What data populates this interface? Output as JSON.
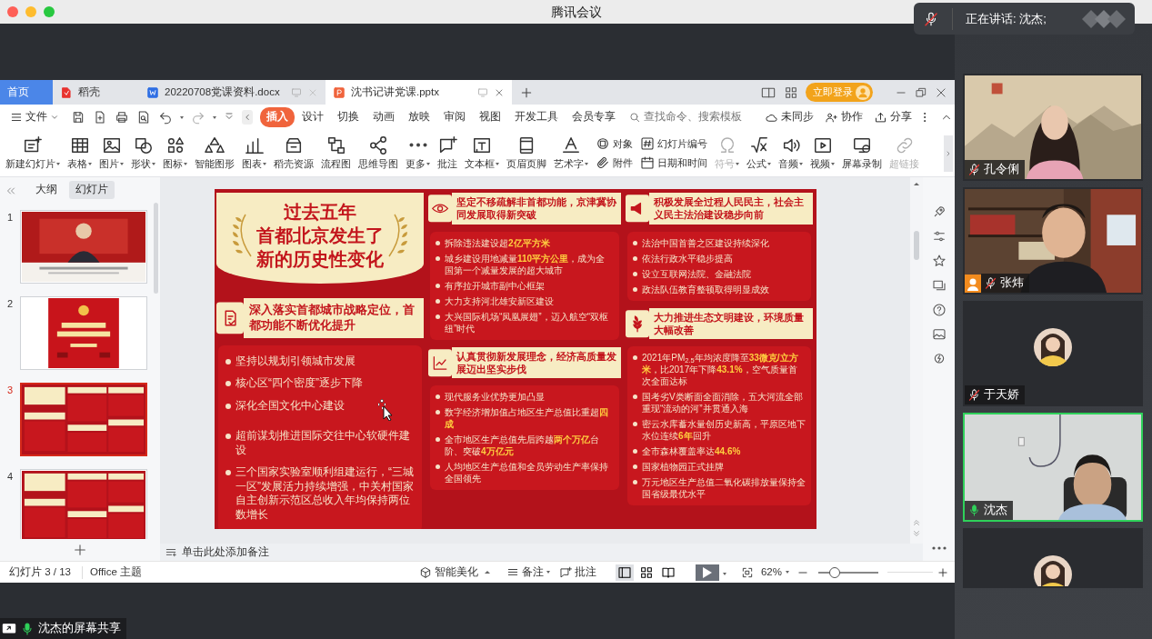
{
  "window": {
    "title": "腾讯会议"
  },
  "speaking_banner": {
    "text": "正在讲话: 沈杰;",
    "mic_muted": true
  },
  "app": {
    "tabs": [
      {
        "label": "首页",
        "kind": "home",
        "selected": false
      },
      {
        "label": "稻壳",
        "kind": "docer",
        "selected": false
      },
      {
        "label": "20220708党课资料.docx",
        "kind": "doc",
        "selected": false
      },
      {
        "label": "沈书记讲党课.pptx",
        "kind": "ppt",
        "selected": true
      }
    ],
    "login_button": "立即登录",
    "file_menu": "文件",
    "menu_tabs": [
      {
        "label": "插入",
        "selected": true
      },
      {
        "label": "设计",
        "selected": false
      },
      {
        "label": "切换",
        "selected": false
      },
      {
        "label": "动画",
        "selected": false
      },
      {
        "label": "放映",
        "selected": false
      },
      {
        "label": "审阅",
        "selected": false
      },
      {
        "label": "视图",
        "selected": false
      },
      {
        "label": "开发工具",
        "selected": false
      },
      {
        "label": "会员专享",
        "selected": false
      }
    ],
    "search": {
      "placeholder": "查找命令、搜索模板"
    },
    "actions": [
      "未同步",
      "协作",
      "分享"
    ],
    "ribbon": [
      {
        "label": "新建幻灯片",
        "kind": "large",
        "dropdown": true,
        "disabled": false
      },
      {
        "label": "表格",
        "kind": "large",
        "dropdown": true,
        "disabled": false
      },
      {
        "label": "图片",
        "kind": "large",
        "dropdown": true,
        "disabled": false
      },
      {
        "label": "形状",
        "kind": "large",
        "dropdown": true,
        "disabled": false
      },
      {
        "label": "图标",
        "kind": "large",
        "dropdown": true,
        "disabled": false
      },
      {
        "label": "智能图形",
        "kind": "large",
        "dropdown": false,
        "disabled": false
      },
      {
        "label": "图表",
        "kind": "large",
        "dropdown": true,
        "disabled": false
      },
      {
        "label": "稻壳资源",
        "kind": "large",
        "dropdown": false,
        "disabled": false
      },
      {
        "label": "流程图",
        "kind": "large",
        "dropdown": false,
        "disabled": false
      },
      {
        "label": "思维导图",
        "kind": "large",
        "dropdown": false,
        "disabled": false
      },
      {
        "label": "更多",
        "kind": "large",
        "dropdown": true,
        "disabled": false
      },
      {
        "label": "批注",
        "kind": "large",
        "dropdown": false,
        "disabled": false
      },
      {
        "label": "文本框",
        "kind": "large",
        "dropdown": true,
        "disabled": false
      },
      {
        "label": "页眉页脚",
        "kind": "large",
        "dropdown": false,
        "disabled": false
      },
      {
        "label": "艺术字",
        "kind": "large",
        "dropdown": true,
        "disabled": false
      },
      {
        "label": "对象",
        "kind": "small",
        "dropdown": false,
        "disabled": false
      },
      {
        "label": "附件",
        "kind": "small",
        "dropdown": false,
        "disabled": false
      },
      {
        "label": "幻灯片编号",
        "kind": "small",
        "dropdown": false,
        "disabled": false
      },
      {
        "label": "日期和时间",
        "kind": "small",
        "dropdown": false,
        "disabled": false
      },
      {
        "label": "符号",
        "kind": "large",
        "dropdown": true,
        "disabled": true
      },
      {
        "label": "公式",
        "kind": "large",
        "dropdown": true,
        "disabled": false
      },
      {
        "label": "音频",
        "kind": "large",
        "dropdown": true,
        "disabled": false
      },
      {
        "label": "视频",
        "kind": "large",
        "dropdown": true,
        "disabled": false
      },
      {
        "label": "屏幕录制",
        "kind": "large",
        "dropdown": false,
        "disabled": false
      },
      {
        "label": "超链接",
        "kind": "large",
        "dropdown": false,
        "disabled": true
      }
    ],
    "panel_tabs": [
      {
        "label": "大纲",
        "selected": false
      },
      {
        "label": "幻灯片",
        "selected": true
      }
    ],
    "thumbnails": [
      {
        "number": "1",
        "selected": false
      },
      {
        "number": "2",
        "selected": false
      },
      {
        "number": "3",
        "selected": true
      },
      {
        "number": "4",
        "selected": false
      }
    ],
    "slide": {
      "title_lines": [
        "过去五年",
        "首都北京发生了",
        "新的历史性变化"
      ],
      "sections": [
        {
          "heading": "深入落实首都城市战略定位，首都功能不断优化提升",
          "items": [
            "坚持以规划引领城市发展",
            "核心区“四个密度”逐步下降",
            "深化全国文化中心建设",
            "超前谋划推进国际交往中心软硬件建设",
            "三个国家实验室顺利组建运行，“三城一区”发展活力持续增强，中关村国家自主创新示范区总收入年均保持两位数增长"
          ]
        },
        {
          "heading": "坚定不移疏解非首都功能，京津冀协同发展取得新突破",
          "items": [
            "拆除违法建设超**2亿平方米**",
            "城乡建设用地减量**110平方公里**，成为全国第一个减量发展的超大城市",
            "有序拉开城市副中心框架",
            "大力支持河北雄安新区建设",
            "大兴国际机场“凤凰展翅”，迈入航空“双枢纽”时代"
          ]
        },
        {
          "heading": "认真贯彻新发展理念，经济高质量发展迈出坚实步伐",
          "items": [
            "现代服务业优势更加凸显",
            "数字经济增加值占地区生产总值比重超**四成**",
            "全市地区生产总值先后跨越**两个万亿**台阶、突破**4万亿元**",
            "人均地区生产总值和全员劳动生产率保持全国领先"
          ]
        },
        {
          "heading": "积极发展全过程人民民主，社会主义民主法治建设稳步向前",
          "items": [
            "法治中国首善之区建设持续深化",
            "依法行政水平稳步提高",
            "设立互联网法院、金融法院",
            "政法队伍教育整顿取得明显成效"
          ]
        },
        {
          "heading": "大力推进生态文明建设，环境质量大幅改善",
          "items": [
            "2021年PM$_{2.5}$年均浓度降至**33微克/立方米**，比2017年下降**43.1%**，空气质量首次全面达标",
            "国考劣V类断面全面消除，五大河流全部重现“流动的河”并贯通入海",
            "密云水库蓄水量创历史新高，平原区地下水位连续**6年**回升",
            "全市森林覆盖率达**44.6%**",
            "国家植物园正式挂牌",
            "万元地区生产总值二氧化碳排放量保持全国省级最优水平"
          ]
        }
      ]
    },
    "notes_placeholder": "单击此处添加备注",
    "status": {
      "slide_counter": "幻灯片 3 / 13",
      "theme": "Office 主题",
      "beautify": "智能美化",
      "notes": "备注",
      "comments": "批注",
      "views": [
        {
          "selected": true
        },
        {
          "selected": false
        },
        {
          "selected": false
        }
      ],
      "zoom": "62%",
      "zoom_slider": {
        "level": 0.27
      }
    }
  },
  "participants": [
    {
      "name": "孔令俐",
      "kind": "video",
      "muted": true,
      "speaking": false,
      "host": false
    },
    {
      "name": "张炜",
      "kind": "video",
      "muted": true,
      "speaking": false,
      "host": true
    },
    {
      "name": "于天娇",
      "kind": "avatar",
      "muted": true,
      "speaking": false,
      "host": false
    },
    {
      "name": "沈杰",
      "kind": "video",
      "muted": false,
      "speaking": true,
      "host": false
    },
    {
      "kind": "avatar",
      "speaking": false,
      "host": false
    }
  ],
  "screen_share": {
    "label": "沈杰的屏幕共享"
  }
}
